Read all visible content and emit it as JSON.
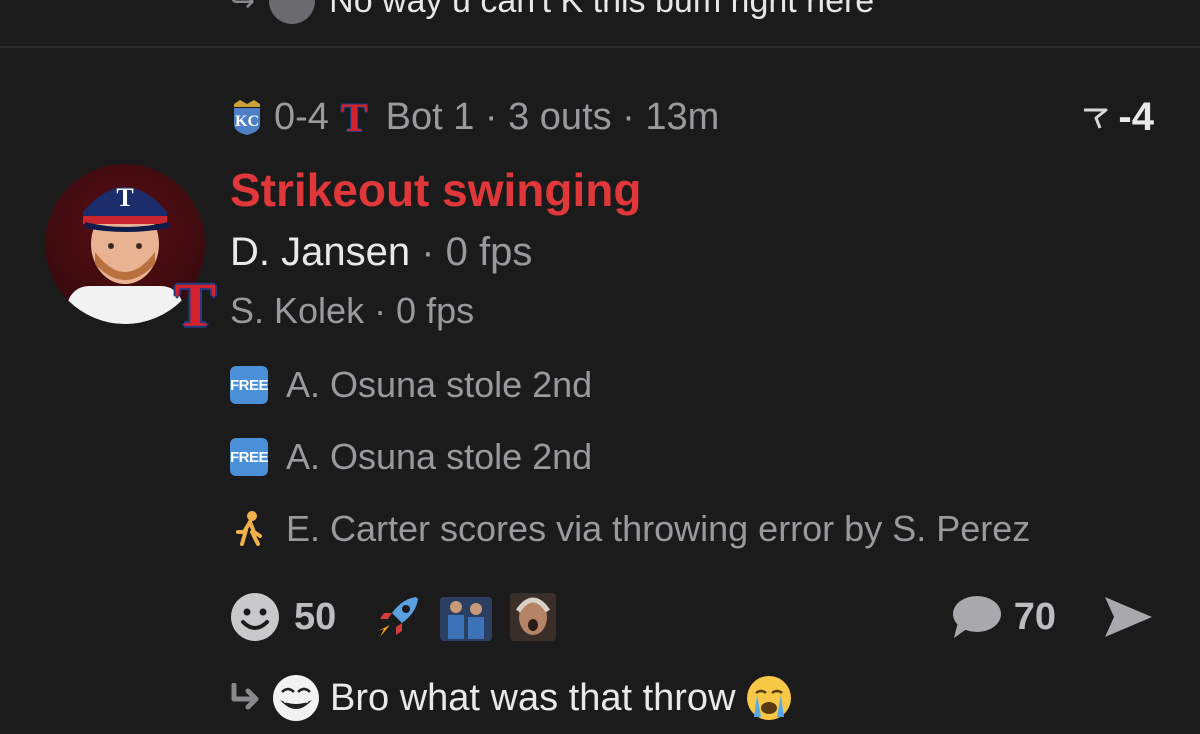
{
  "prev_reply": {
    "text": "No way u can't K this bum right here"
  },
  "header": {
    "away_team_icon": "kc-royals-logo",
    "score": "0-4",
    "home_team_icon": "rangers-t-logo",
    "inning_info": "Bot 1 · 3 outs · 13m",
    "points": "-4",
    "points_icon": "flag-icon"
  },
  "play": {
    "title": "Strikeout swinging",
    "title_color": "#e0383a",
    "primary_player": "D. Jansen",
    "primary_fps": "· 0 fps",
    "secondary_line": "S. Kolek · 0 fps"
  },
  "events": [
    {
      "icon": "free-badge",
      "badge_text": "FREE",
      "text": "A. Osuna stole 2nd"
    },
    {
      "icon": "free-badge",
      "badge_text": "FREE",
      "text": "A. Osuna stole 2nd"
    },
    {
      "icon": "runner-icon",
      "text": "E. Carter scores via throwing error by S. Perez"
    }
  ],
  "reactions": {
    "smiley_count": "50",
    "comments_count": "70"
  },
  "reply": {
    "text": "Bro what was that throw"
  }
}
